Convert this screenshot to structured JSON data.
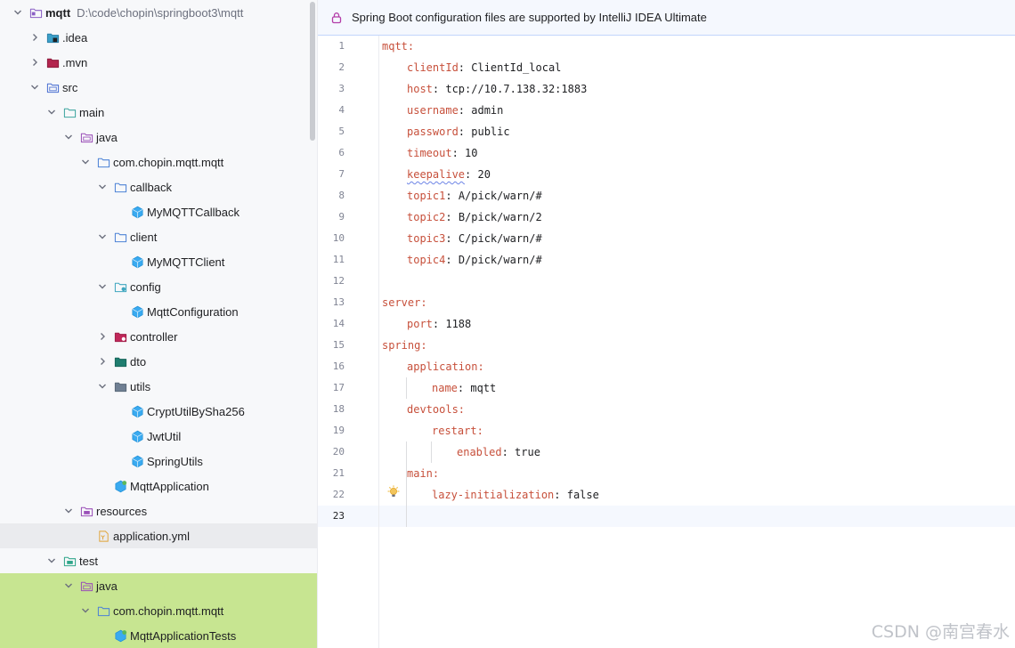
{
  "colors": {
    "tree_bg": "#f7f8fa",
    "highlight_bg": "#c7e591",
    "selected_bg": "#eaebee",
    "key": "#c7503b",
    "banner_bg": "#f5f8fe"
  },
  "tree": {
    "items": [
      {
        "label": "mqtt",
        "path": "D:\\code\\chopin\\springboot3\\mqtt",
        "icon": "module-folder-icon",
        "expanded": true,
        "depth": 0,
        "bold": true
      },
      {
        "label": ".idea",
        "icon": "idea-folder-icon",
        "expanded": false,
        "depth": 1
      },
      {
        "label": ".mvn",
        "icon": "mvn-folder-icon",
        "expanded": false,
        "depth": 1
      },
      {
        "label": "src",
        "icon": "source-folder-icon",
        "expanded": true,
        "depth": 1
      },
      {
        "label": "main",
        "icon": "folder-icon",
        "expanded": true,
        "depth": 2
      },
      {
        "label": "java",
        "icon": "source-root-icon",
        "expanded": true,
        "depth": 3
      },
      {
        "label": "com.chopin.mqtt.mqtt",
        "icon": "package-icon",
        "expanded": true,
        "depth": 4
      },
      {
        "label": "callback",
        "icon": "package-icon",
        "expanded": true,
        "depth": 5
      },
      {
        "label": "MyMQTTCallback",
        "icon": "class-icon",
        "expanded": null,
        "depth": 6
      },
      {
        "label": "client",
        "icon": "package-icon",
        "expanded": true,
        "depth": 5
      },
      {
        "label": "MyMQTTClient",
        "icon": "class-icon",
        "expanded": null,
        "depth": 6
      },
      {
        "label": "config",
        "icon": "config-package-icon",
        "expanded": true,
        "depth": 5
      },
      {
        "label": "MqttConfiguration",
        "icon": "class-icon",
        "expanded": null,
        "depth": 6
      },
      {
        "label": "controller",
        "icon": "controller-folder-icon",
        "expanded": false,
        "depth": 5
      },
      {
        "label": "dto",
        "icon": "dto-folder-icon",
        "expanded": false,
        "depth": 5
      },
      {
        "label": "utils",
        "icon": "utils-folder-icon",
        "expanded": true,
        "depth": 5
      },
      {
        "label": "CryptUtilBySha256",
        "icon": "class-icon",
        "expanded": null,
        "depth": 6
      },
      {
        "label": "JwtUtil",
        "icon": "class-icon",
        "expanded": null,
        "depth": 6
      },
      {
        "label": "SpringUtils",
        "icon": "class-icon",
        "expanded": null,
        "depth": 6
      },
      {
        "label": "MqttApplication",
        "icon": "spring-class-icon",
        "expanded": null,
        "depth": 5
      },
      {
        "label": "resources",
        "icon": "resources-folder-icon",
        "expanded": true,
        "depth": 3
      },
      {
        "label": "application.yml",
        "icon": "yaml-file-icon",
        "expanded": null,
        "depth": 4,
        "selected": true
      },
      {
        "label": "test",
        "icon": "test-folder-icon",
        "expanded": true,
        "depth": 2
      },
      {
        "label": "java",
        "icon": "source-root-icon",
        "expanded": true,
        "depth": 3,
        "highlight": true
      },
      {
        "label": "com.chopin.mqtt.mqtt",
        "icon": "package-icon",
        "expanded": true,
        "depth": 4,
        "highlight": true
      },
      {
        "label": "MqttApplicationTests",
        "icon": "spring-class-icon",
        "expanded": null,
        "depth": 5,
        "highlight": true
      }
    ]
  },
  "banner": {
    "text": "Spring Boot configuration files are supported by IntelliJ IDEA Ultimate",
    "icon": "lock-icon"
  },
  "editor": {
    "current_line": 23,
    "lines": [
      {
        "n": "1",
        "indent": 0,
        "key": "mqtt",
        "sep": ":",
        "value": ""
      },
      {
        "n": "2",
        "indent": 1,
        "key": "clientId",
        "sep": ": ",
        "value": "ClientId_local"
      },
      {
        "n": "3",
        "indent": 1,
        "key": "host",
        "sep": ": ",
        "value": "tcp://10.7.138.32:1883"
      },
      {
        "n": "4",
        "indent": 1,
        "key": "username",
        "sep": ": ",
        "value": "admin"
      },
      {
        "n": "5",
        "indent": 1,
        "key": "password",
        "sep": ": ",
        "value": "public"
      },
      {
        "n": "6",
        "indent": 1,
        "key": "timeout",
        "sep": ": ",
        "value": "10"
      },
      {
        "n": "7",
        "indent": 1,
        "key": "keepalive",
        "sep": ": ",
        "value": "20",
        "squiggle": true
      },
      {
        "n": "8",
        "indent": 1,
        "key": "topic1",
        "sep": ": ",
        "value": "A/pick/warn/#"
      },
      {
        "n": "9",
        "indent": 1,
        "key": "topic2",
        "sep": ": ",
        "value": "B/pick/warn/2"
      },
      {
        "n": "10",
        "indent": 1,
        "key": "topic3",
        "sep": ": ",
        "value": "C/pick/warn/#"
      },
      {
        "n": "11",
        "indent": 1,
        "key": "topic4",
        "sep": ": ",
        "value": "D/pick/warn/#"
      },
      {
        "n": "12",
        "indent": 0,
        "key": "",
        "sep": "",
        "value": ""
      },
      {
        "n": "13",
        "indent": 0,
        "key": "server",
        "sep": ":",
        "value": ""
      },
      {
        "n": "14",
        "indent": 1,
        "key": "port",
        "sep": ": ",
        "value": "1188"
      },
      {
        "n": "15",
        "indent": 0,
        "key": "spring",
        "sep": ":",
        "value": ""
      },
      {
        "n": "16",
        "indent": 1,
        "key": "application",
        "sep": ":",
        "value": ""
      },
      {
        "n": "17",
        "indent": 2,
        "key": "name",
        "sep": ": ",
        "value": "mqtt"
      },
      {
        "n": "18",
        "indent": 1,
        "key": "devtools",
        "sep": ":",
        "value": ""
      },
      {
        "n": "19",
        "indent": 2,
        "key": "restart",
        "sep": ":",
        "value": ""
      },
      {
        "n": "20",
        "indent": 3,
        "key": "enabled",
        "sep": ": ",
        "value": "true"
      },
      {
        "n": "21",
        "indent": 1,
        "key": "main",
        "sep": ":",
        "value": ""
      },
      {
        "n": "22",
        "indent": 2,
        "key": "lazy-initialization",
        "sep": ": ",
        "value": "false"
      },
      {
        "n": "23",
        "indent": 0,
        "key": "",
        "sep": "",
        "value": ""
      }
    ]
  },
  "watermark": "CSDN @南宫春水"
}
